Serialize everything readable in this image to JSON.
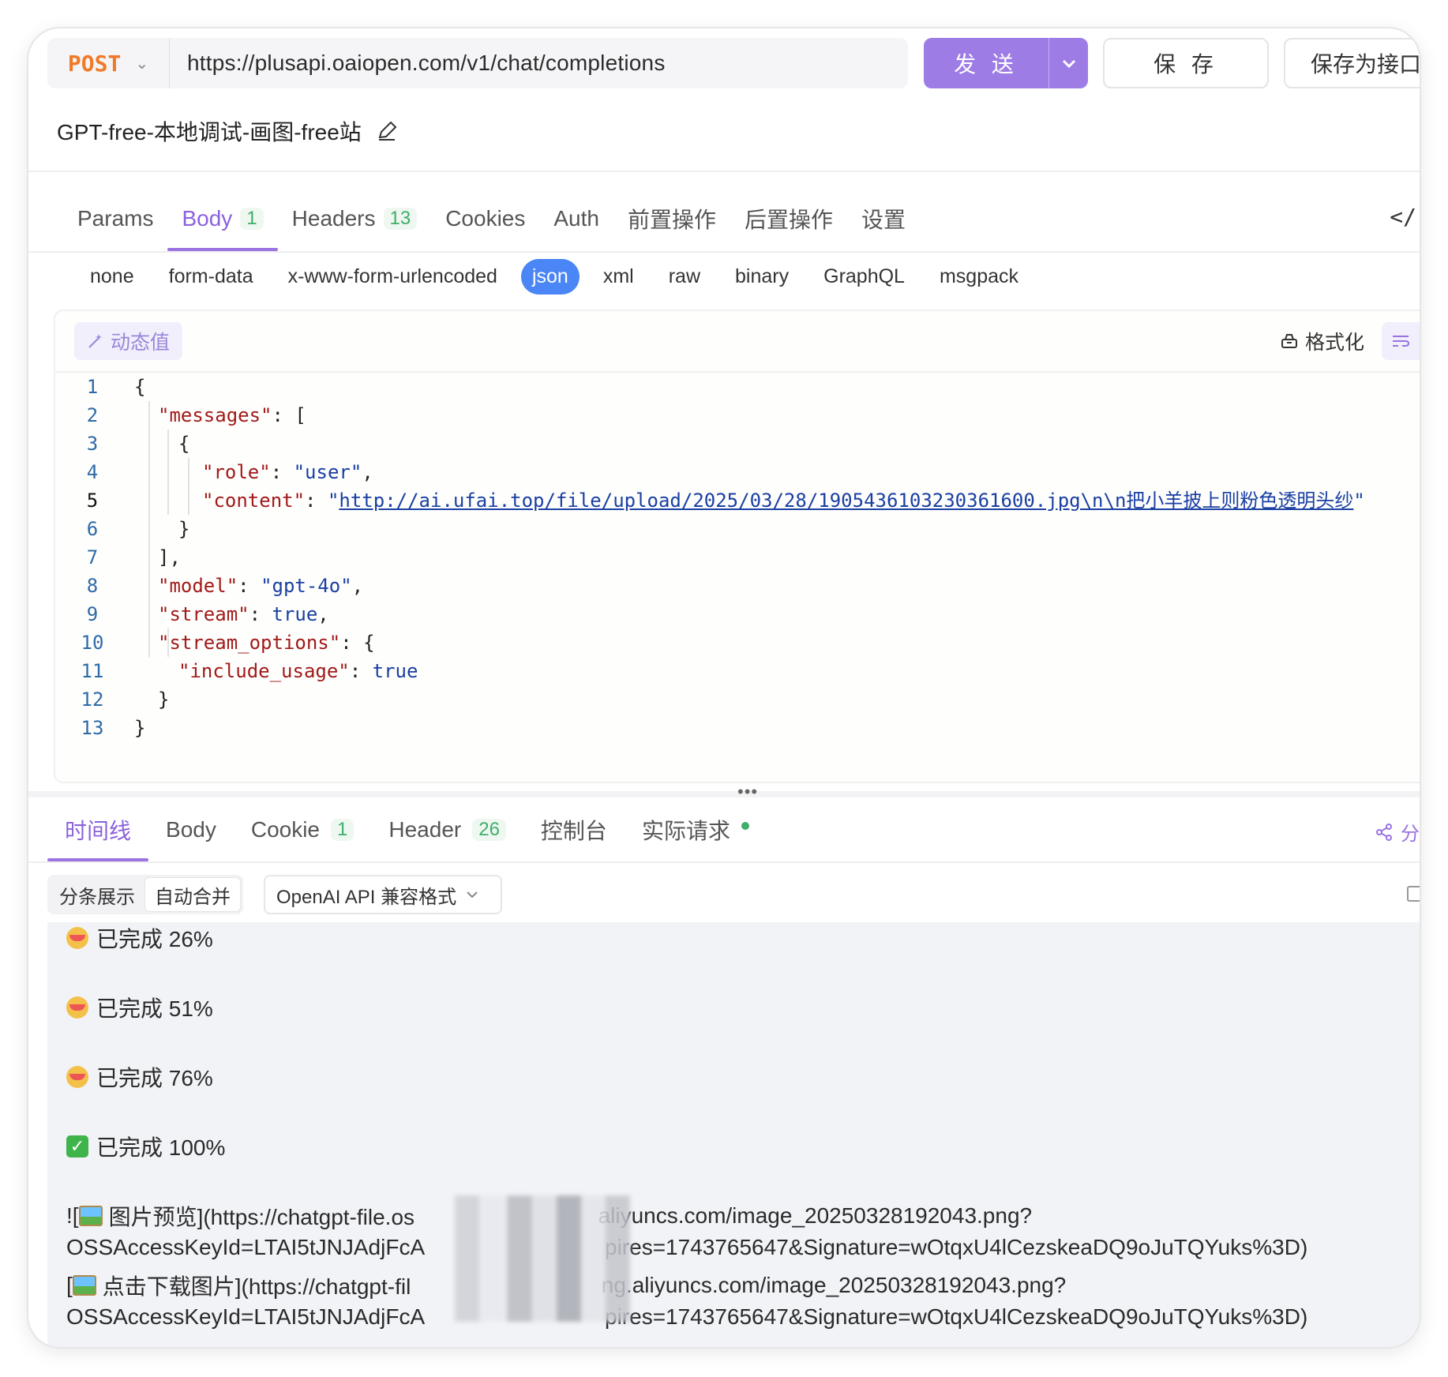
{
  "request": {
    "method": "POST",
    "url": "https://plusapi.oaiopen.com/v1/chat/completions",
    "send_label": "发 送",
    "save_label": "保 存",
    "save_as_api_label": "保存为接口"
  },
  "title": "GPT-free-本地调试-画图-free站",
  "tabs": [
    {
      "label": "Params"
    },
    {
      "label": "Body",
      "badge": "1"
    },
    {
      "label": "Headers",
      "badge": "13"
    },
    {
      "label": "Cookies"
    },
    {
      "label": "Auth"
    },
    {
      "label": "前置操作"
    },
    {
      "label": "后置操作"
    },
    {
      "label": "设置"
    }
  ],
  "body_types": [
    "none",
    "form-data",
    "x-www-form-urlencoded",
    "json",
    "xml",
    "raw",
    "binary",
    "GraphQL",
    "msgpack"
  ],
  "body_type_selected": "json",
  "editor": {
    "dynamic_label": "动态值",
    "format_label": "格式化",
    "code": {
      "l1": "{",
      "l2_key": "\"messages\"",
      "l2_rest": ": [",
      "l3": "{",
      "l4_key": "\"role\"",
      "l4_val": "\"user\"",
      "l5_key": "\"content\"",
      "l5_q1": "\"",
      "l5_url": "http://ai.ufai.top/file/upload/2025/03/28/1905436103230361600.jpg\\n\\n把小羊披上则粉色透明头纱",
      "l5_q2": "\"",
      "l6": "}",
      "l7": "],",
      "l8_key": "\"model\"",
      "l8_val": "\"gpt-4o\"",
      "l9_key": "\"stream\"",
      "l9_val": "true",
      "l10_key": "\"stream_options\"",
      "l10_rest": ": {",
      "l11_key": "\"include_usage\"",
      "l11_val": "true",
      "l12": "}",
      "l13": "}"
    },
    "line_numbers": [
      "1",
      "2",
      "3",
      "4",
      "5",
      "6",
      "7",
      "8",
      "9",
      "10",
      "11",
      "12",
      "13"
    ]
  },
  "response": {
    "tabs": [
      {
        "label": "时间线"
      },
      {
        "label": "Body"
      },
      {
        "label": "Cookie",
        "badge": "1"
      },
      {
        "label": "Header",
        "badge": "26"
      },
      {
        "label": "控制台"
      },
      {
        "label": "实际请求"
      }
    ],
    "share_label": "分",
    "view_modes": [
      "分条展示",
      "自动合并"
    ],
    "format_select": "OpenAI API 兼容格式",
    "lines": {
      "p26": "已完成 26%",
      "p51": "已完成 51%",
      "p76": "已完成 76%",
      "p100": "已完成 100%",
      "img1a_pre": "![",
      "img1a_text": "图片预览](https://chatgpt-file.os",
      "img1a_post": "aliyuncs.com/image_20250328192043.png?",
      "img1b_pre": "OSSAccessKeyId=LTAI5tJNJAdjFcA",
      "img1b_post": "pires=1743765647&Signature=wOtqxU4lCezskeaDQ9oJuTQYuks%3D)",
      "img2a_pre": "[",
      "img2a_text": "点击下载图片](https://chatgpt-fil",
      "img2a_post": "ng.aliyuncs.com/image_20250328192043.png?",
      "img2b_pre": "OSSAccessKeyId=LTAI5tJNJAdjFcA",
      "img2b_post": "pires=1743765647&Signature=wOtqxU4lCezskeaDQ9oJuTQYuks%3D)"
    }
  },
  "colors": {
    "accent": "#9e7ce6",
    "method": "#f07a29",
    "json_pill": "#4a86f5",
    "badge_green": "#3fae6a"
  }
}
